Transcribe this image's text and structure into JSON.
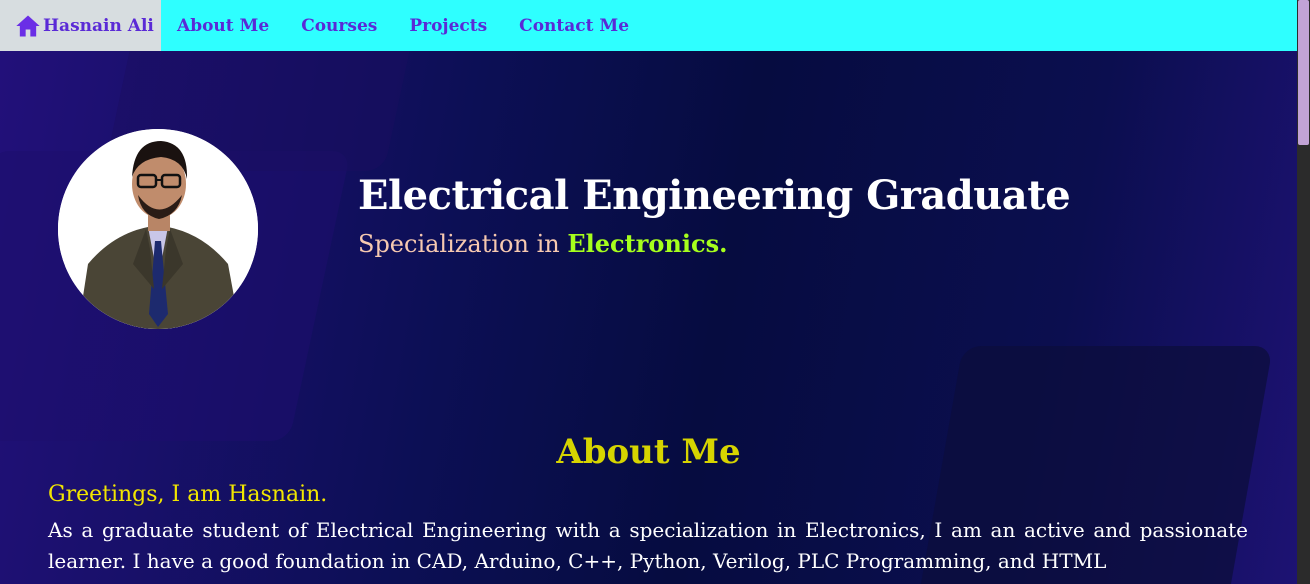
{
  "nav": {
    "home_label": "Hasnain Ali",
    "home_icon": "home-icon",
    "links": [
      "About Me",
      "Courses",
      "Projects",
      "Contact Me"
    ],
    "colors": {
      "bar": "#2effff",
      "text": "#5a2ad6",
      "home_bg": "#d7dde0"
    }
  },
  "hero": {
    "headline": "Electrical Engineering Graduate",
    "sub_prefix": "Specialization in ",
    "sub_highlight": "Electronics.",
    "avatar": "profile-photo"
  },
  "about": {
    "title": "About Me",
    "greeting": "Greetings, I am Hasnain.",
    "text": "As a graduate student of Electrical Engineering with a specialization in Electronics, I am an active and passionate learner. I have a good foundation in CAD, Arduino, C++, Python, Verilog, PLC Programming, and HTML"
  }
}
